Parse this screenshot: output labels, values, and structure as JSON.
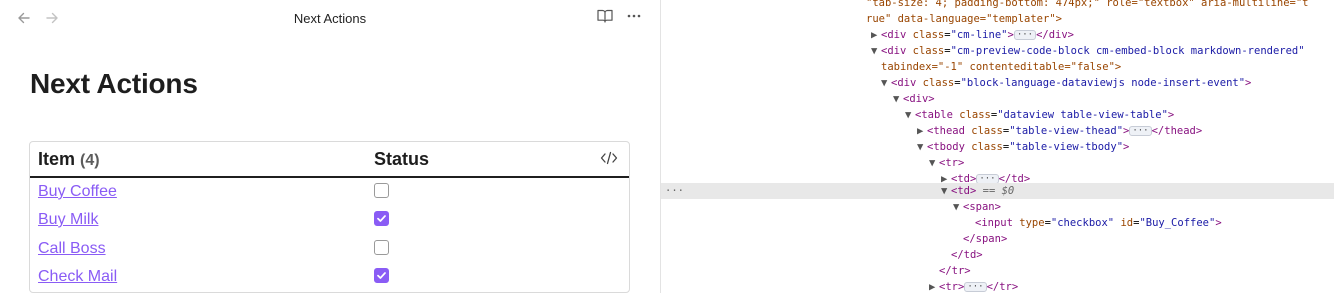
{
  "tab": {
    "title": "Next Actions"
  },
  "page": {
    "heading": "Next Actions"
  },
  "table": {
    "col_item": "Item",
    "count": "(4)",
    "col_status": "Status",
    "rows": [
      {
        "label": "Buy Coffee",
        "checked": false
      },
      {
        "label": "Buy Milk",
        "checked": true
      },
      {
        "label": "Call Boss",
        "checked": false
      },
      {
        "label": "Check Mail",
        "checked": true
      }
    ]
  },
  "colors": {
    "accent": "#8a5cf5"
  },
  "icons": {
    "back": "arrow-left-icon",
    "forward": "arrow-right-icon",
    "reading": "book-open-icon",
    "more": "more-horizontal-icon",
    "code": "code-icon"
  },
  "devtools": {
    "lines": [
      {
        "an": "\"tab-size: 4; padding-bottom: 474px;\" role=\"textbox\" aria-multiline=\"t"
      },
      {
        "an": "rue\" data-language=\"templater\">"
      },
      {
        "tri": "▶",
        "tag": "div",
        "attr": "cm-line",
        "tail": "</div>"
      },
      {
        "tri": "▼",
        "tag": "div",
        "attr": "cm-preview-code-block cm-embed-block markdown-rendered"
      },
      {
        "an": "tabindex=\"-1\" contenteditable=\"false\">"
      },
      {
        "tri": "▼",
        "tag": "div",
        "attr": "block-language-dataviewjs node-insert-event"
      },
      {
        "tri": "▼",
        "tag": "div"
      },
      {
        "tri": "▼",
        "tag": "table",
        "attr": "dataview table-view-table"
      },
      {
        "tri": "▶",
        "tag": "thead",
        "attr": "table-view-thead",
        "tail": "</thead>"
      },
      {
        "tri": "▼",
        "tag": "tbody",
        "attr": "table-view-tbody"
      },
      {
        "tri": "▼",
        "tag": "tr"
      },
      {
        "tri": "▶",
        "tag": "td",
        "tail": "</td>"
      },
      {
        "tri": "▼",
        "tag": "td",
        "eq": "== $0"
      },
      {
        "tri": "▼",
        "tag": "span"
      },
      {
        "tag": "input",
        "attr": "checkbox",
        "attr2": "Buy_Coffee"
      },
      {
        "tag": "/span"
      },
      {
        "tag": "/td"
      },
      {
        "tag": "/tr"
      },
      {
        "tri": "▶",
        "tag": "tr",
        "tail": "</tr>"
      }
    ]
  }
}
